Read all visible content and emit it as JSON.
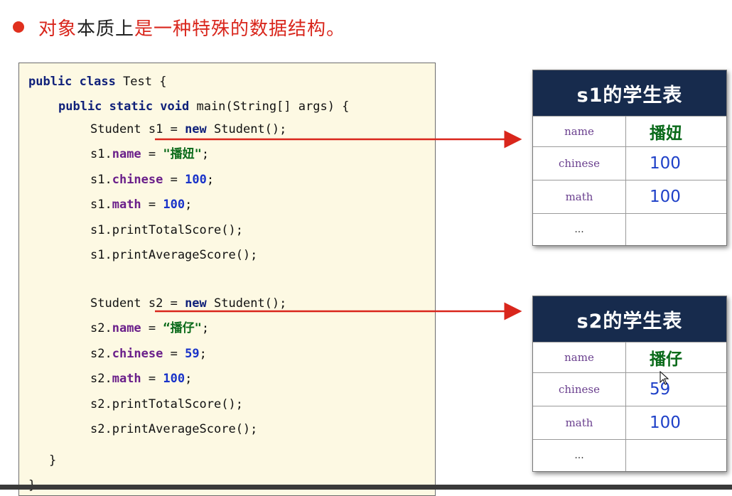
{
  "heading": {
    "part1": "对象",
    "part2": "本质上",
    "part3": "是一种特殊的数据结构。"
  },
  "code": {
    "lines": [
      {
        "tokens": [
          {
            "t": "public class",
            "c": "kw"
          },
          {
            "t": " Test {",
            "c": ""
          }
        ]
      },
      {
        "tokens": [
          {
            "t": "public static void",
            "c": "kw"
          },
          {
            "t": " main(String[] args) {",
            "c": ""
          }
        ]
      },
      {
        "tokens": [
          {
            "t": "Student s1 = ",
            "c": ""
          },
          {
            "t": "new",
            "c": "kw"
          },
          {
            "t": " Student();",
            "c": ""
          }
        ]
      },
      {
        "tokens": [
          {
            "t": "s1.",
            "c": ""
          },
          {
            "t": "name",
            "c": "fld"
          },
          {
            "t": " = ",
            "c": ""
          },
          {
            "t": "\"播妞\"",
            "c": "str"
          },
          {
            "t": ";",
            "c": ""
          }
        ]
      },
      {
        "tokens": [
          {
            "t": "s1.",
            "c": ""
          },
          {
            "t": "chinese",
            "c": "fld"
          },
          {
            "t": " = ",
            "c": ""
          },
          {
            "t": "100",
            "c": "num"
          },
          {
            "t": ";",
            "c": ""
          }
        ]
      },
      {
        "tokens": [
          {
            "t": "s1.",
            "c": ""
          },
          {
            "t": "math",
            "c": "fld"
          },
          {
            "t": " = ",
            "c": ""
          },
          {
            "t": "100",
            "c": "num"
          },
          {
            "t": ";",
            "c": ""
          }
        ]
      },
      {
        "tokens": [
          {
            "t": "s1.printTotalScore();",
            "c": ""
          }
        ]
      },
      {
        "tokens": [
          {
            "t": "s1.printAverageScore();",
            "c": ""
          }
        ]
      },
      {
        "tokens": [
          {
            "t": "Student s2 = ",
            "c": ""
          },
          {
            "t": "new",
            "c": "kw"
          },
          {
            "t": " Student();",
            "c": ""
          }
        ]
      },
      {
        "tokens": [
          {
            "t": "s2.",
            "c": ""
          },
          {
            "t": "name",
            "c": "fld"
          },
          {
            "t": " = ",
            "c": ""
          },
          {
            "t": "“播仔\"",
            "c": "str"
          },
          {
            "t": ";",
            "c": ""
          }
        ]
      },
      {
        "tokens": [
          {
            "t": "s2.",
            "c": ""
          },
          {
            "t": "chinese",
            "c": "fld"
          },
          {
            "t": " = ",
            "c": ""
          },
          {
            "t": "59",
            "c": "num"
          },
          {
            "t": ";",
            "c": ""
          }
        ]
      },
      {
        "tokens": [
          {
            "t": "s2.",
            "c": ""
          },
          {
            "t": "math",
            "c": "fld"
          },
          {
            "t": " = ",
            "c": ""
          },
          {
            "t": "100",
            "c": "num"
          },
          {
            "t": ";",
            "c": ""
          }
        ]
      },
      {
        "tokens": [
          {
            "t": "s2.printTotalScore();",
            "c": ""
          }
        ]
      },
      {
        "tokens": [
          {
            "t": "s2.printAverageScore();",
            "c": ""
          }
        ]
      },
      {
        "tokens": [
          {
            "t": "}",
            "c": ""
          }
        ]
      },
      {
        "tokens": [
          {
            "t": "}",
            "c": ""
          }
        ]
      }
    ]
  },
  "tables": [
    {
      "title": "s1的学生表",
      "rows": [
        {
          "key": "name",
          "value": "播妞"
        },
        {
          "key": "chinese",
          "value": "100"
        },
        {
          "key": "math",
          "value": "100"
        },
        {
          "key": "...",
          "value": ""
        }
      ]
    },
    {
      "title": "s2的学生表",
      "rows": [
        {
          "key": "name",
          "value": "播仔"
        },
        {
          "key": "chinese",
          "value": "59"
        },
        {
          "key": "math",
          "value": "100"
        },
        {
          "key": "...",
          "value": ""
        }
      ]
    }
  ],
  "colors": {
    "accent_red": "#d9261c",
    "table_header": "#172b4d",
    "code_bg": "#fdf9e3"
  }
}
